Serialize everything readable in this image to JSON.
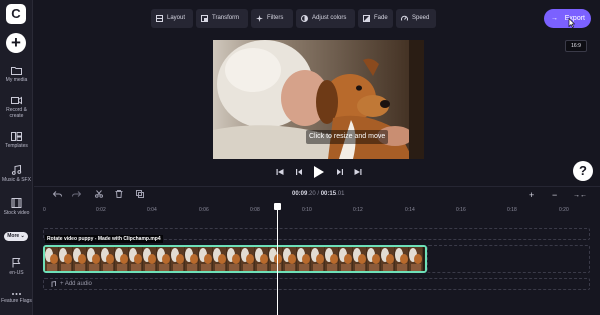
{
  "left_rail": {
    "logo_letter": "C",
    "create_symbol": "+",
    "items": [
      {
        "label": "My media",
        "icon": "folder-icon"
      },
      {
        "label": "Record & create",
        "icon": "camera-icon"
      },
      {
        "label": "Templates",
        "icon": "templates-icon"
      },
      {
        "label": "Music & SFX",
        "icon": "music-icon"
      },
      {
        "label": "Stock video",
        "icon": "film-icon"
      }
    ],
    "more_label": "More",
    "bottom_items": [
      {
        "label": "en-US",
        "icon": "flag-icon"
      },
      {
        "label": "Feature Flags",
        "icon": "dots-icon"
      }
    ]
  },
  "toolbar": {
    "layout": "Layout",
    "transform": "Transform",
    "filters": "Filters",
    "adjust_colors": "Adjust colors",
    "fade": "Fade",
    "speed": "Speed"
  },
  "export_label": "Export",
  "aspect_ratio": "16:9",
  "preview": {
    "hint": "Click to resize and move"
  },
  "help_symbol": "?",
  "timecode": {
    "current_main": "00:09",
    "current_frac": ".20",
    "separator": " / ",
    "total_main": "00:15",
    "total_frac": ".01"
  },
  "ruler": [
    "0",
    "0:02",
    "0:04",
    "0:06",
    "0:08",
    "0:10",
    "0:12",
    "0:14",
    "0:16",
    "0:18"
  ],
  "timeline": {
    "clip_title": "Rotate video puppy - Made with Clipchamp.mp4",
    "add_audio": "+ Add audio"
  },
  "colors": {
    "accent": "#7b61ff",
    "clip_border": "#6ee0b8",
    "background": "#161620"
  }
}
